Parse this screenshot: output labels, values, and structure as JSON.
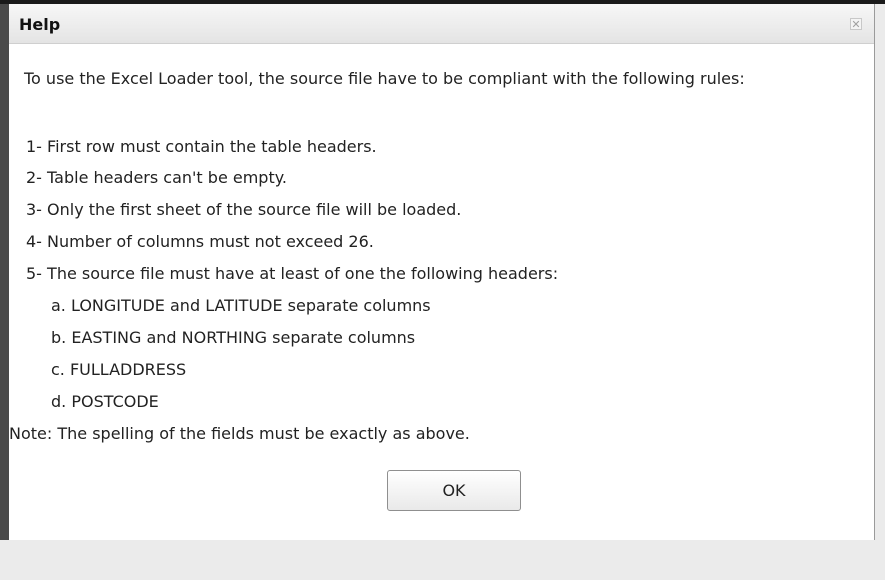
{
  "dialog": {
    "title": "Help",
    "close_glyph": "✕",
    "intro": "To use the Excel Loader tool, the source file have to be compliant with the following rules:",
    "rules": [
      "1- First row must contain the table headers.",
      "2- Table headers can't be empty.",
      "3- Only the first sheet of the source file will be loaded.",
      "4- Number of columns must not exceed 26.",
      "5- The source file must have at least of one the following headers:"
    ],
    "headers": [
      "a. LONGITUDE and LATITUDE separate columns",
      "b. EASTING and NORTHING separate columns",
      "c. FULLADDRESS",
      "d. POSTCODE"
    ],
    "note": "Note: The spelling of the fields must be exactly as above.",
    "ok_label": "OK"
  },
  "icons": {
    "close": "close-icon"
  },
  "colors": {
    "titlebar": "#e4e4e4",
    "border": "#8f8f8f",
    "text": "#222222"
  }
}
